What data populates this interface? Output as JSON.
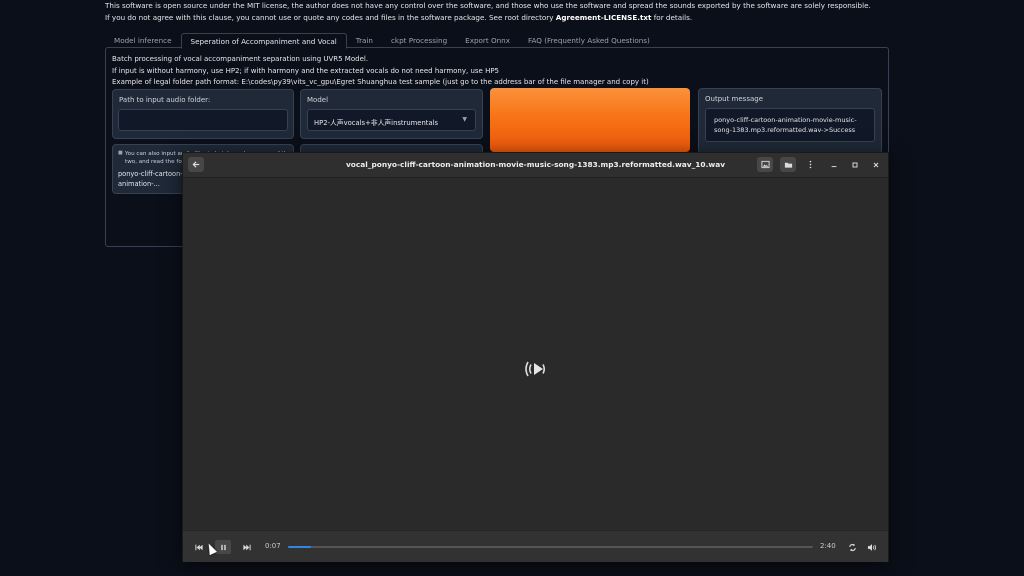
{
  "notice": {
    "line1": "This software is open source under the MIT license, the author does not have any control over the software, and those who use the software and spread the sounds exported by the software are solely responsible.",
    "line2_prefix": "If you do not agree with this clause, you cannot use or quote any codes and files in the software package. See root directory ",
    "line2_bold": "Agreement-LICENSE.txt",
    "line2_suffix": " for details."
  },
  "tabs": [
    {
      "label": "Model inference",
      "active": false
    },
    {
      "label": "Seperation of Accompaniment and Vocal",
      "active": true
    },
    {
      "label": "Train",
      "active": false
    },
    {
      "label": "ckpt Processing",
      "active": false
    },
    {
      "label": "Export Onnx",
      "active": false
    },
    {
      "label": "FAQ (Frequently Asked Questions)",
      "active": false
    }
  ],
  "description": {
    "line1": "Batch processing of vocal accompaniment separation using UVR5 Model.",
    "line2": "If input is without harmony, use HP2; if with harmony and the extracted vocals do not need harmony, use HP5",
    "line3": "Example of legal folder path format: E:\\codes\\py39\\vits_vc_gpu\\Egret Shuanghua test sample (just go to the address bar of the file manager and copy it)"
  },
  "input_path": {
    "label": "Path to input audio folder:",
    "value": ""
  },
  "model": {
    "label": "Model",
    "selected": "HP2-人声vocals+非人声instrumentals"
  },
  "output": {
    "label": "Output message",
    "value": "ponyo-cliff-cartoon-animation-movie-music-song-1383.mp3.reformatted.wav->Success"
  },
  "batch": {
    "hint": "You can also input audio files in batches, choose one of the two, and read the fold",
    "file": "ponyo-cliff-cartoon-animation-..."
  },
  "player": {
    "title": "vocal_ponyo-cliff-cartoon-animation-movie-music-song-1383.mp3.reformatted.wav_10.wav",
    "current_time": "0:07",
    "total_time": "2:40",
    "progress": 0.044,
    "accent": "#3584e4"
  },
  "icons": {
    "back": "back-arrow-icon",
    "screenshot": "screenshot-icon",
    "folder": "open-folder-icon",
    "menu": "kebab-menu-icon",
    "minimize": "minimize-icon",
    "maximize": "maximize-icon",
    "close": "close-icon",
    "audio": "audio-stream-icon",
    "prev": "skip-previous-icon",
    "pause": "pause-icon",
    "next": "skip-next-icon",
    "repeat": "repeat-icon",
    "volume": "volume-icon"
  }
}
